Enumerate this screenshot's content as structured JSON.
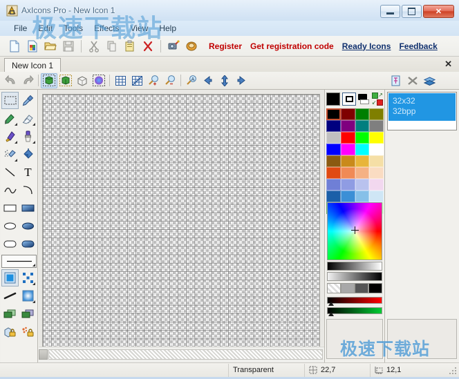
{
  "window": {
    "title": "AxIcons Pro - New Icon 1",
    "app_icon": "axicons-app-icon",
    "minimize_label": "Minimize",
    "maximize_label": "Maximize",
    "close_label": "Close"
  },
  "menubar": {
    "items": [
      {
        "label": "File"
      },
      {
        "label": "Edit"
      },
      {
        "label": "Tools"
      },
      {
        "label": "Effects"
      },
      {
        "label": "View"
      },
      {
        "label": "Help"
      }
    ]
  },
  "toolbar": {
    "buttons": [
      {
        "name": "new-icon-button",
        "icon": "new-document-icon"
      },
      {
        "name": "new-image-button",
        "icon": "new-image-icon"
      },
      {
        "name": "open-button",
        "icon": "open-folder-icon"
      },
      {
        "name": "save-button",
        "icon": "save-diskette-icon",
        "disabled": true
      },
      {
        "name": "cut-button",
        "icon": "scissors-icon",
        "disabled": true
      },
      {
        "name": "copy-button",
        "icon": "copy-icon",
        "disabled": true
      },
      {
        "name": "paste-button",
        "icon": "clipboard-paste-icon",
        "disabled": true
      },
      {
        "name": "delete-button",
        "icon": "red-x-icon"
      },
      {
        "name": "capture-button",
        "icon": "screen-capture-icon"
      },
      {
        "name": "library-button",
        "icon": "book-icon"
      }
    ],
    "links": [
      {
        "label": "Register",
        "style": "red"
      },
      {
        "label": "Get registration code",
        "style": "red"
      },
      {
        "label": "Ready Icons",
        "style": "navy"
      },
      {
        "label": "Feedback",
        "style": "navy"
      }
    ]
  },
  "tabs": {
    "items": [
      {
        "label": "New Icon 1",
        "active": true
      }
    ],
    "close_glyph": "✕"
  },
  "toolbar2": {
    "buttons": [
      {
        "name": "undo-button",
        "icon": "undo-arrow-icon",
        "disabled": true
      },
      {
        "name": "redo-button",
        "icon": "redo-arrow-icon",
        "disabled": true
      },
      {
        "name": "import-image-button",
        "icon": "green-cube-select-icon"
      },
      {
        "name": "export-image-button",
        "icon": "green-cube-export-icon"
      },
      {
        "name": "cube-3d-button",
        "icon": "wire-cube-icon"
      },
      {
        "name": "glow-effect-button",
        "icon": "blue-glow-icon"
      },
      {
        "name": "grid-button",
        "icon": "grid-icon"
      },
      {
        "name": "pixel-grid-button",
        "icon": "pixel-grid-icon"
      },
      {
        "name": "zoom-in-button",
        "icon": "magnifier-plus-icon"
      },
      {
        "name": "zoom-out-button",
        "icon": "magnifier-minus-icon"
      },
      {
        "name": "zoom-actual-button",
        "icon": "magnifier-a-icon"
      },
      {
        "name": "align-left-button",
        "icon": "arrow-left-icon"
      },
      {
        "name": "align-center-button",
        "icon": "arrow-updown-icon"
      },
      {
        "name": "align-right-button",
        "icon": "arrow-right-icon"
      }
    ],
    "right_buttons": [
      {
        "name": "new-format-button",
        "icon": "format-page-icon"
      },
      {
        "name": "delete-format-button",
        "icon": "delete-format-icon"
      },
      {
        "name": "layers-button",
        "icon": "layers-icon"
      }
    ]
  },
  "tool_palette": {
    "rows": [
      [
        {
          "name": "rect-select-tool",
          "icon": "rectangle-select-icon",
          "active": true
        },
        {
          "name": "eyedropper-tool",
          "icon": "eyedropper-icon"
        }
      ],
      [
        {
          "name": "pencil-tool",
          "icon": "pencil-icon",
          "has_menu": true
        },
        {
          "name": "eraser-tool",
          "icon": "eraser-icon",
          "has_menu": true
        }
      ],
      [
        {
          "name": "marker-tool",
          "icon": "marker-icon",
          "has_menu": true
        },
        {
          "name": "brush-tool",
          "icon": "paintbrush-icon",
          "has_menu": true
        }
      ],
      [
        {
          "name": "airbrush-tool",
          "icon": "airbrush-icon",
          "has_menu": true
        },
        {
          "name": "paint-bucket-tool",
          "icon": "paint-bucket-icon"
        }
      ],
      [
        {
          "name": "line-tool",
          "icon": "line-icon"
        },
        {
          "name": "text-tool",
          "icon": "text-t-icon"
        }
      ],
      [
        {
          "name": "curve-tool",
          "icon": "wave-curve-icon"
        },
        {
          "name": "arc-tool",
          "icon": "arc-icon"
        }
      ],
      [
        {
          "name": "rectangle-outline-tool",
          "icon": "rectangle-outline-icon"
        },
        {
          "name": "rectangle-filled-tool",
          "icon": "rectangle-filled-icon"
        }
      ],
      [
        {
          "name": "ellipse-outline-tool",
          "icon": "ellipse-outline-icon"
        },
        {
          "name": "ellipse-filled-tool",
          "icon": "ellipse-filled-icon"
        }
      ],
      [
        {
          "name": "round-rect-outline-tool",
          "icon": "rounded-rect-outline-icon"
        },
        {
          "name": "round-rect-filled-tool",
          "icon": "rounded-rect-filled-icon"
        }
      ]
    ],
    "line_width_selector": {
      "name": "line-width-selector",
      "icon": "line-width-icon"
    },
    "rows2": [
      [
        {
          "name": "fill-solid-option",
          "icon": "solid-fill-icon",
          "active": true
        },
        {
          "name": "fill-pattern-option",
          "icon": "pattern-fill-icon",
          "has_menu": true
        }
      ],
      [
        {
          "name": "smooth-option",
          "icon": "smooth-stroke-icon"
        },
        {
          "name": "gradient-option",
          "icon": "gradient-fill-icon",
          "has_menu": true
        }
      ],
      [
        {
          "name": "layer-front-option",
          "icon": "layer-green-icon"
        },
        {
          "name": "layer-back-option",
          "icon": "layer-purple-icon"
        }
      ],
      [
        {
          "name": "lock-opaque-option",
          "icon": "lock-blue-icon"
        },
        {
          "name": "lock-alpha-option",
          "icon": "lock-orange-icon"
        }
      ]
    ]
  },
  "palette": {
    "foreground_color": "#000000",
    "background_color": "#ffffff",
    "swatches": [
      "#000000",
      "#7f0000",
      "#007f00",
      "#7f7f00",
      "#00007f",
      "#7f007f",
      "#007f7f",
      "#7f7f7f",
      "#c0c0c0",
      "#ff0000",
      "#00ff00",
      "#ffff00",
      "#0000ff",
      "#ff00ff",
      "#00ffff",
      "#ffffff",
      "#8a5a11",
      "#c98a1b",
      "#e8b53a",
      "#f5dfa6",
      "#e04a12",
      "#f08a56",
      "#f5b184",
      "#fadcc2",
      "#6f7fd6",
      "#8f9ce3",
      "#b9c2ee",
      "#f2d8ef",
      "#1b5fa8",
      "#3b8fd6",
      "#86c0e8",
      "#cfe6f5",
      "#0f8a2a",
      "#4fbf55",
      "#8ede8c",
      "#c9f0c0"
    ],
    "current_swatch_index": 0,
    "alpha_swatches": [
      "#ffffff",
      "#a8a8a8",
      "#555555",
      "#000000"
    ]
  },
  "formats": {
    "items": [
      {
        "size": "32x32",
        "depth": "32bpp",
        "selected": true
      }
    ]
  },
  "statusbar": {
    "transparency": "Transparent",
    "cursor_position": "22,7",
    "image_size": "12,1",
    "position_icon": "crosshair-select-icon",
    "size_icon": "size-measure-icon"
  },
  "watermark": {
    "top_text": "极速下载站",
    "bottom_text": "极速下载站"
  }
}
